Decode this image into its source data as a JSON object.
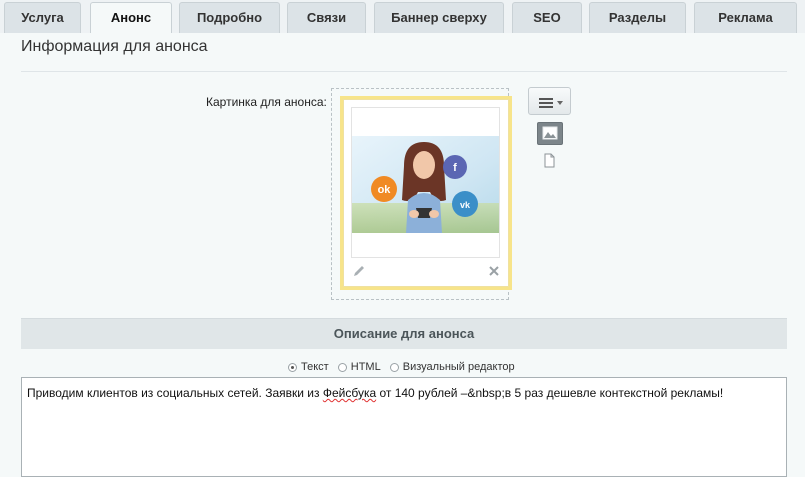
{
  "tabs": [
    {
      "label": "Услуга",
      "active": false
    },
    {
      "label": "Анонс",
      "active": true
    },
    {
      "label": "Подробно",
      "active": false
    },
    {
      "label": "Связи",
      "active": false
    },
    {
      "label": "Баннер сверху",
      "active": false
    },
    {
      "label": "SEO",
      "active": false
    },
    {
      "label": "Разделы",
      "active": false
    },
    {
      "label": "Реклама",
      "active": false
    }
  ],
  "section_title": "Информация для анонса",
  "picture_field": {
    "label": "Картинка для анонса:",
    "social_badges": [
      "ok",
      "f",
      "vk"
    ]
  },
  "description": {
    "header": "Описание для анонса",
    "modes": [
      {
        "label": "Текст",
        "selected": true
      },
      {
        "label": "HTML",
        "selected": false
      },
      {
        "label": "Визуальный редактор",
        "selected": false
      }
    ],
    "text_before": "Приводим клиентов из социальных сетей. Заявки из ",
    "text_misspelled": "Фейсбука",
    "text_after": " от 140 рублей –&nbsp;в 5 раз дешевле контекстной рекламы!"
  },
  "colors": {
    "accent_frame": "#f7e48a",
    "header_bg": "#e0e6e8",
    "tab_bg": "#dce3e7"
  }
}
